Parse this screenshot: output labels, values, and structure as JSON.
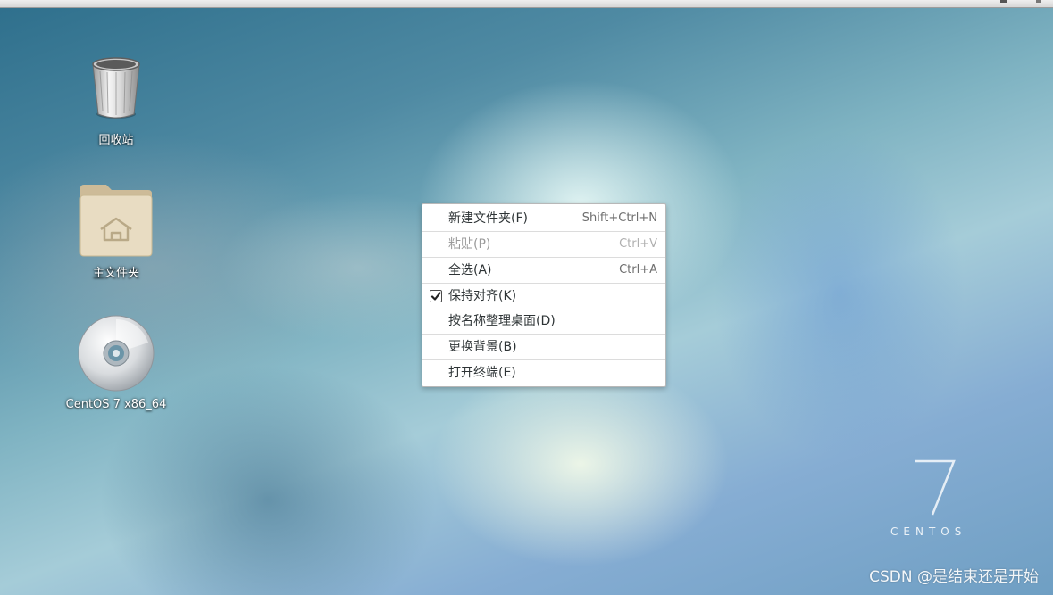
{
  "desktop": {
    "icons": [
      {
        "label": "回收站",
        "icon": "trash-icon"
      },
      {
        "label": "主文件夹",
        "icon": "home-folder-icon"
      },
      {
        "label": "CentOS 7 x86_64",
        "icon": "optical-disc-icon"
      }
    ]
  },
  "context_menu": {
    "items": [
      {
        "label": "新建文件夹(F)",
        "shortcut": "Shift+Ctrl+N",
        "enabled": true
      },
      {
        "label": "粘贴(P)",
        "shortcut": "Ctrl+V",
        "enabled": false
      },
      {
        "label": "全选(A)",
        "shortcut": "Ctrl+A",
        "enabled": true
      },
      {
        "label": "保持对齐(K)",
        "checked": true,
        "enabled": true
      },
      {
        "label": "按名称整理桌面(D)",
        "enabled": true
      },
      {
        "label": "更换背景(B)",
        "enabled": true
      },
      {
        "label": "打开终端(E)",
        "enabled": true
      }
    ]
  },
  "branding": {
    "version_numeral": "7",
    "os_name": "CENTOS"
  },
  "watermark": {
    "text": "CSDN @是结束还是开始"
  },
  "colors": {
    "menu_bg": "#ffffff",
    "menu_text": "#2e3436",
    "disabled_text": "#9a9a9a",
    "folder_tan": "#e8dcc2"
  }
}
